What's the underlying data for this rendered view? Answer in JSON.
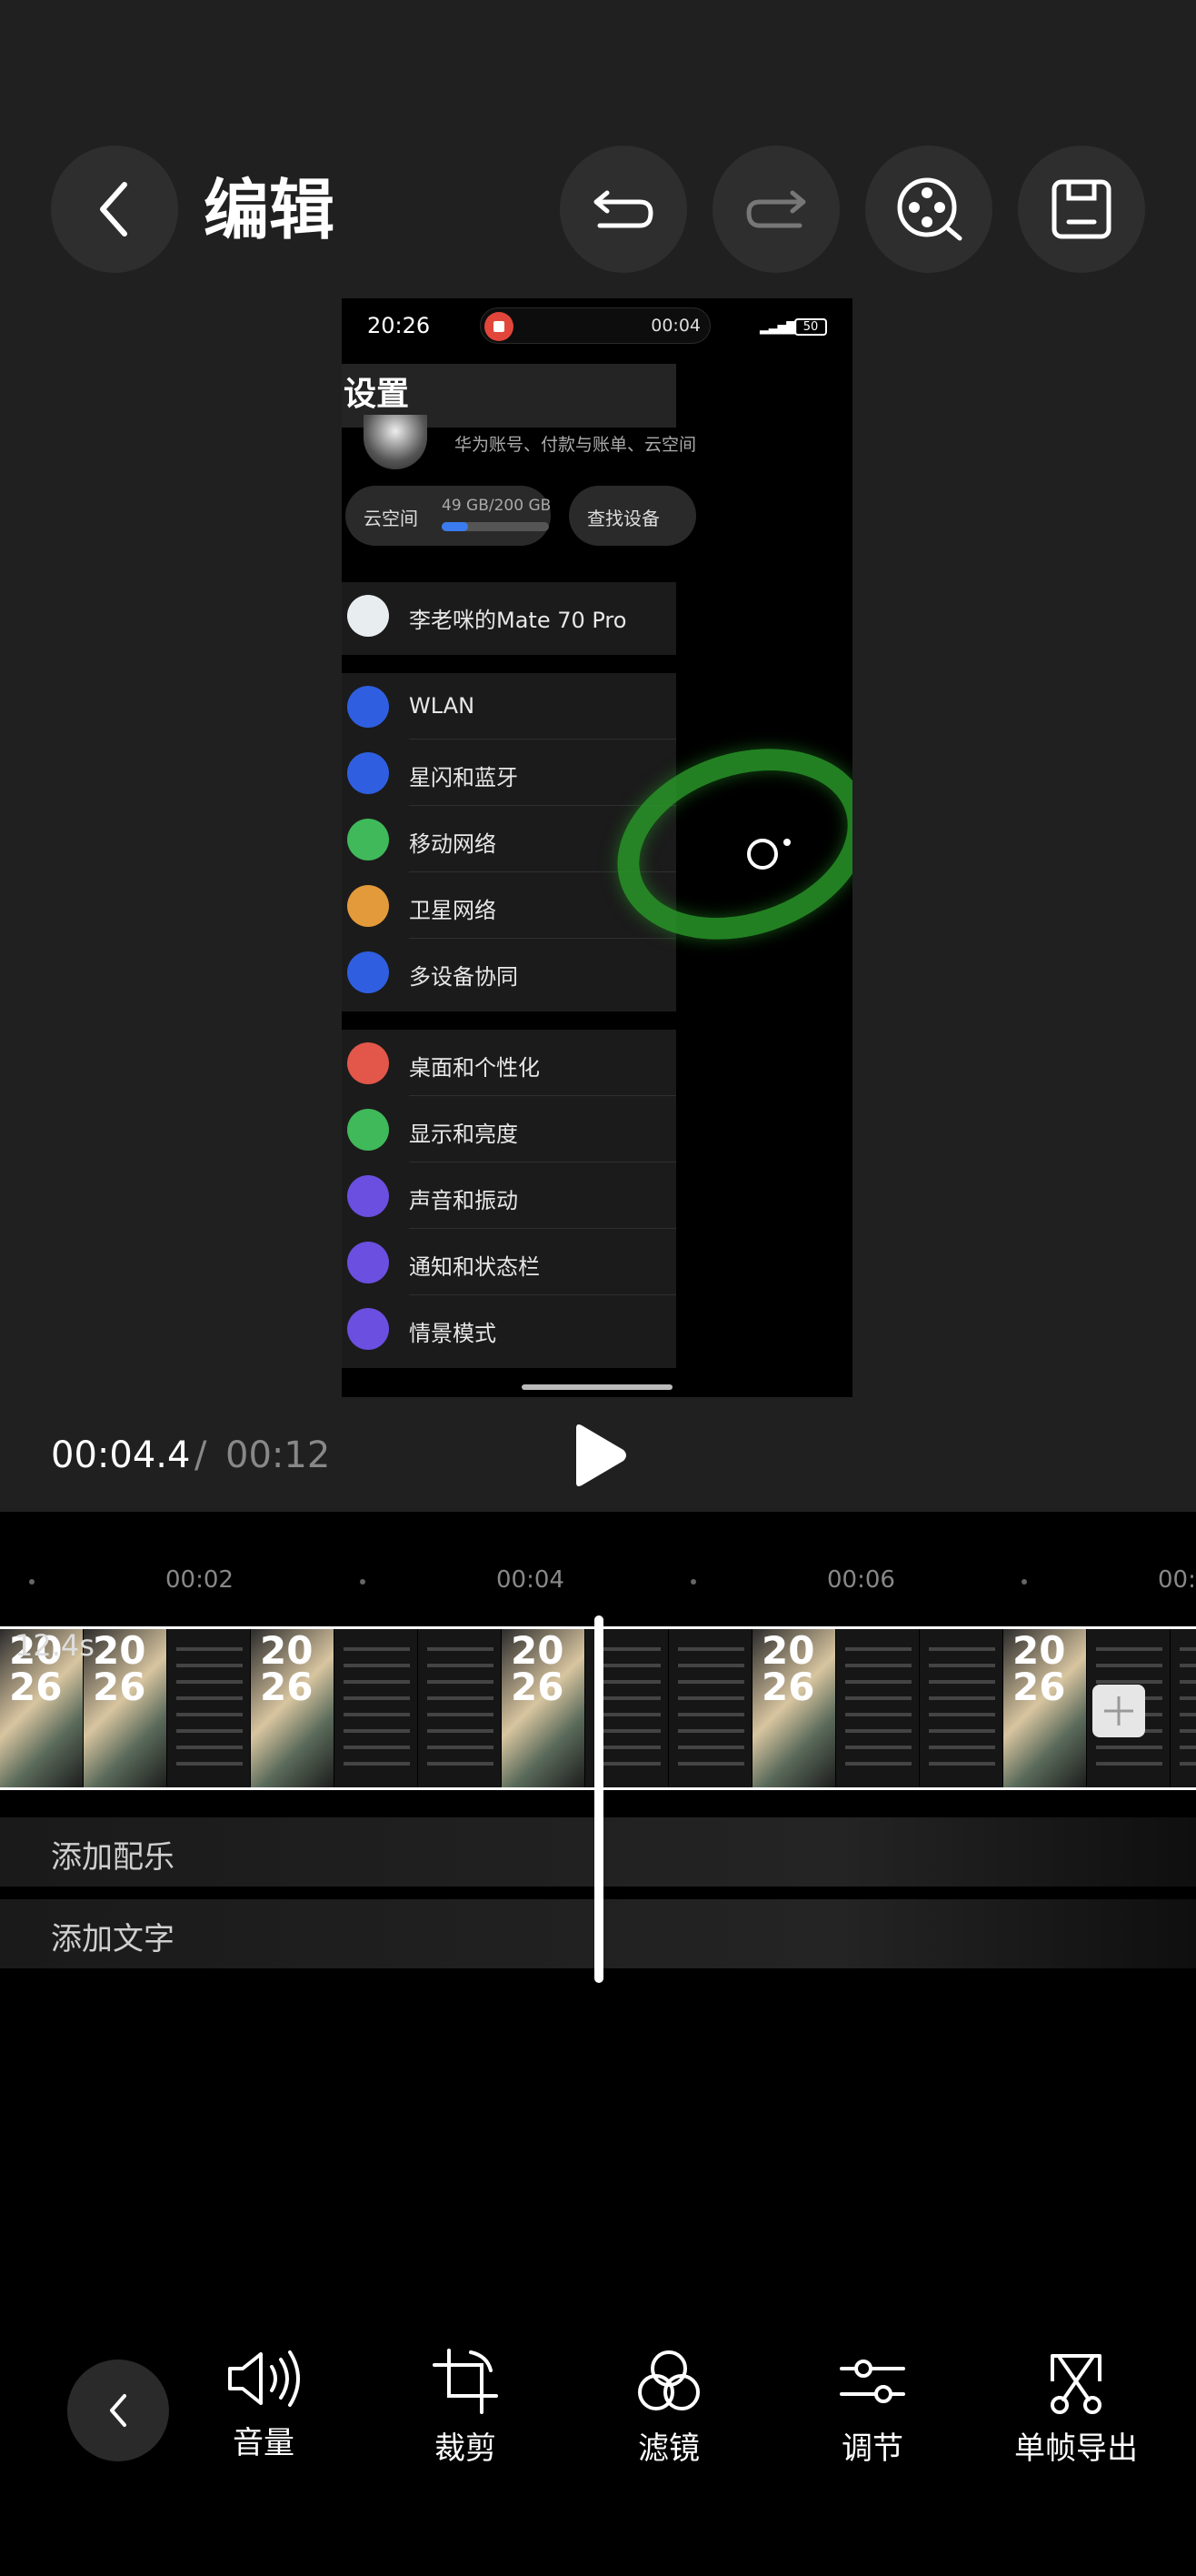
{
  "header": {
    "title": "编辑"
  },
  "preview": {
    "status_time": "20:26",
    "recording_time": "00:04",
    "battery": "50",
    "settings_title": "设置",
    "account_desc": "华为账号、付款与账单、云空间",
    "cloud_label": "云空间",
    "cloud_size": "49 GB/200 GB",
    "cloud_used_fraction": 0.245,
    "find_device": "查找设备",
    "device_name": "李老咪的Mate 70 Pro",
    "group1": [
      {
        "label": "WLAN",
        "icon": "wifi-icon",
        "color": "#2f5fe0"
      },
      {
        "label": "星闪和蓝牙",
        "icon": "bluetooth-icon",
        "color": "#2f5fe0"
      },
      {
        "label": "移动网络",
        "icon": "mobile-network-icon",
        "color": "#3fb95a"
      },
      {
        "label": "卫星网络",
        "icon": "satellite-icon",
        "color": "#e39a3a"
      },
      {
        "label": "多设备协同",
        "icon": "multi-device-icon",
        "color": "#2f5fe0"
      }
    ],
    "group2": [
      {
        "label": "桌面和个性化",
        "icon": "brush-icon",
        "color": "#e2574a"
      },
      {
        "label": "显示和亮度",
        "icon": "eye-icon",
        "color": "#3fb95a"
      },
      {
        "label": "声音和振动",
        "icon": "volume-icon",
        "color": "#6a4fe0"
      },
      {
        "label": "通知和状态栏",
        "icon": "bell-icon",
        "color": "#6a4fe0"
      },
      {
        "label": "情景模式",
        "icon": "profile-icon",
        "color": "#6a4fe0"
      }
    ]
  },
  "playback": {
    "current": "00:04.4",
    "separator": "/",
    "total": "00:12"
  },
  "timeline": {
    "ticks": [
      "00:02",
      "00:04",
      "00:06",
      "00:0"
    ],
    "clip_duration": "12.4s",
    "thumb_text": "20\n26"
  },
  "tracks": {
    "music": "添加配乐",
    "text": "添加文字"
  },
  "toolbar": {
    "volume": "音量",
    "crop": "裁剪",
    "filter": "滤镜",
    "adjust": "调节",
    "frame_export": "单帧导出"
  }
}
